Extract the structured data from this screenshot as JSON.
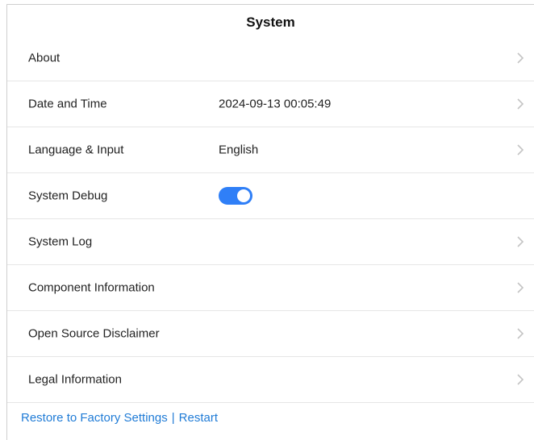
{
  "header": {
    "title": "System"
  },
  "rows": [
    {
      "label": "About",
      "value": ""
    },
    {
      "label": "Date and Time",
      "value": "2024-09-13 00:05:49"
    },
    {
      "label": "Language & Input",
      "value": "English"
    },
    {
      "label": "System Debug",
      "toggle": true
    },
    {
      "label": "System Log",
      "value": ""
    },
    {
      "label": "Component Information",
      "value": ""
    },
    {
      "label": "Open Source Disclaimer",
      "value": ""
    },
    {
      "label": "Legal Information",
      "value": ""
    }
  ],
  "footer": {
    "restore_label": "Restore to Factory Settings",
    "separator": "|",
    "restart_label": "Restart"
  },
  "colors": {
    "accent": "#2f7ff7",
    "link": "#1f7bd6"
  },
  "icons": {
    "row_chevron": "chevron-right-icon"
  }
}
